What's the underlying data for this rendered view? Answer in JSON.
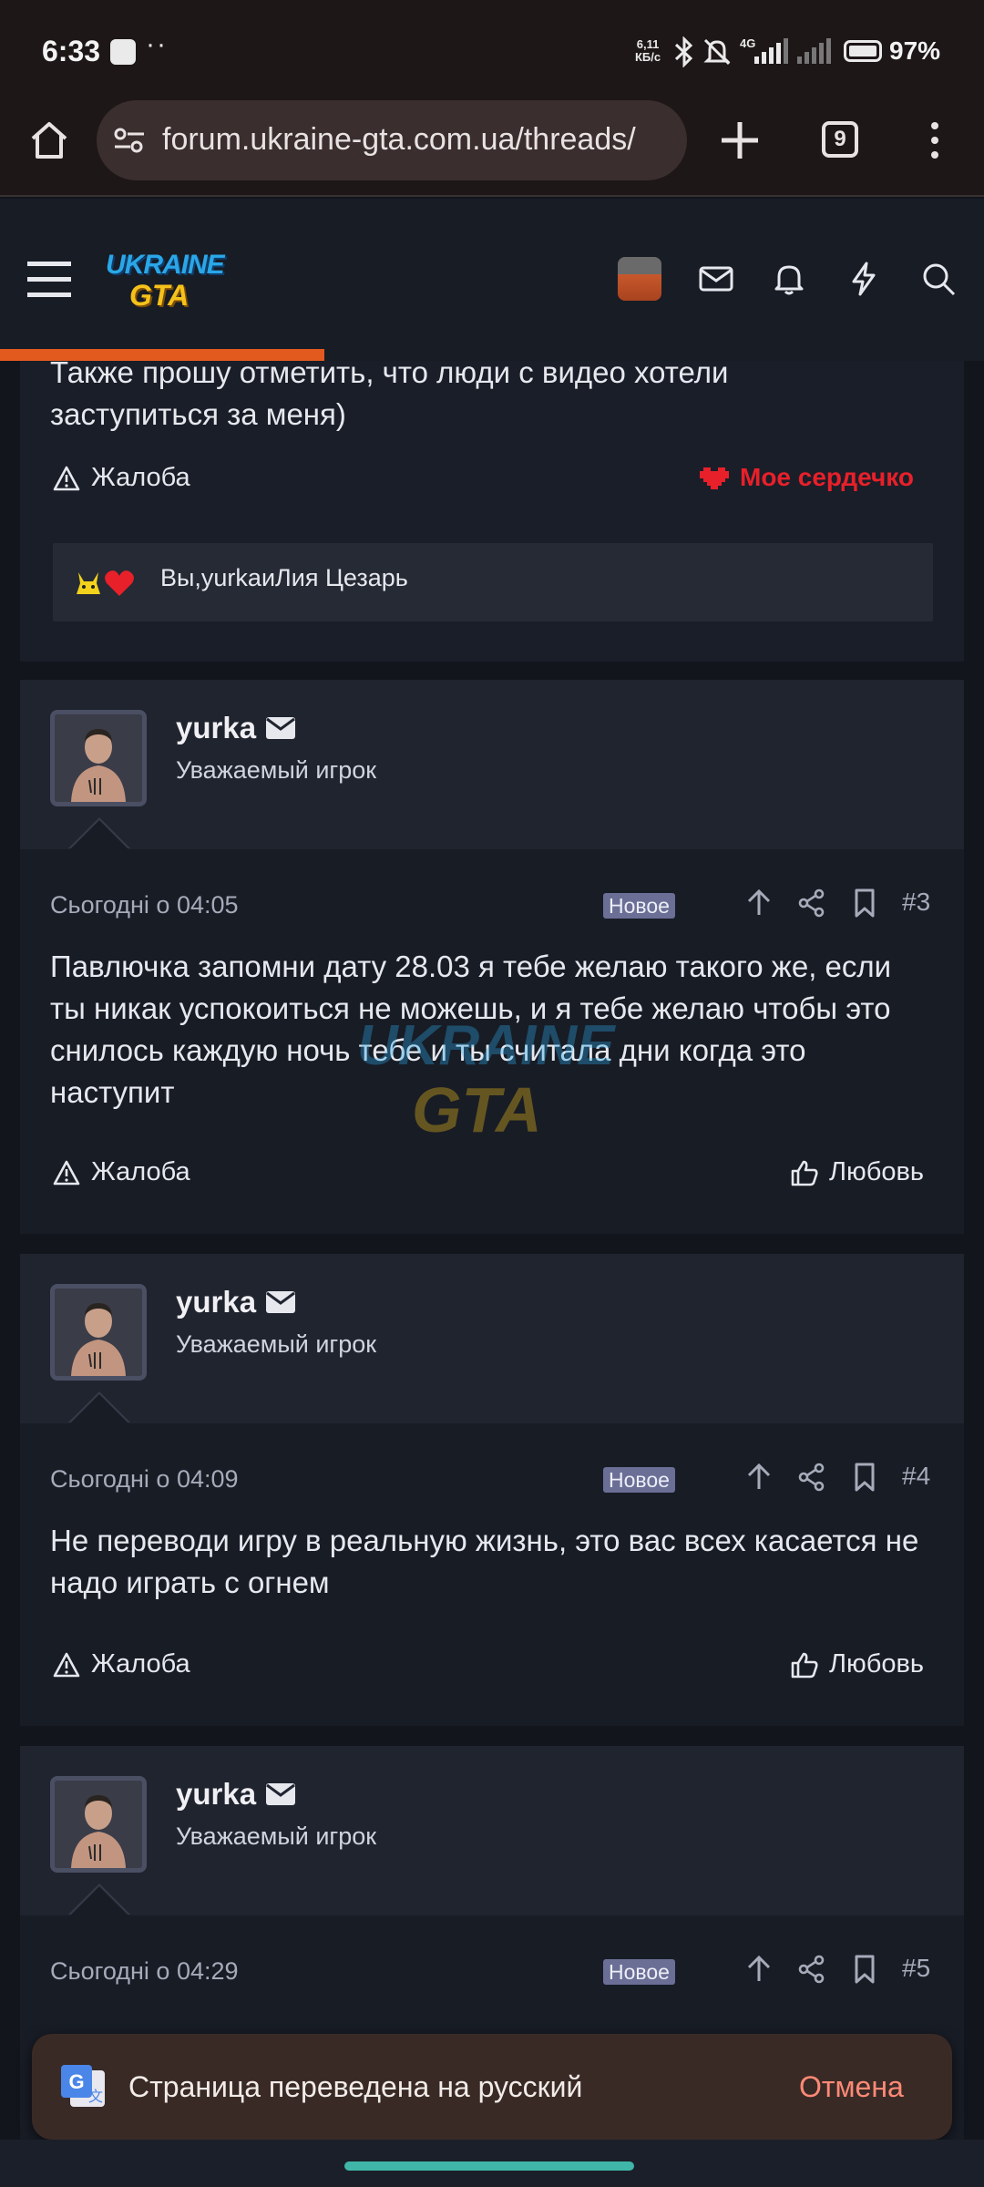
{
  "status_bar": {
    "time": "6:33",
    "net_speed_value": "6,11",
    "net_speed_unit": "КБ/с",
    "network": "4G",
    "battery": "97%"
  },
  "browser": {
    "url": "forum.ukraine-gta.com.ua/threads/",
    "tab_count": "9"
  },
  "site": {
    "logo_top": "UKRAINE",
    "logo_bottom": "GTA",
    "read_progress": 0.33
  },
  "top_post": {
    "text_line1": "Также прошу отметить, что люди с видео хотели",
    "text_line2": "заступиться за меня)",
    "report_label": "Жалоба",
    "reaction_label": "Мое сердечко",
    "reactions_text": "Вы,yurkaиЛия Цезарь"
  },
  "posts": [
    {
      "username": "yurka",
      "user_title": "Уважаемый игрок",
      "date": "Сьогодні о 04:05",
      "badge": "Новое",
      "number": "#3",
      "body": "Павлючка запомни дату 28.03 я тебе желаю такого же, если ты никак успокоиться не можешь, и я тебе желаю чтобы это снилось каждую ночь тебе и ты считала дни когда это наступит",
      "report_label": "Жалоба",
      "like_label": "Любовь"
    },
    {
      "username": "yurka",
      "user_title": "Уважаемый игрок",
      "date": "Сьогодні о 04:09",
      "badge": "Новое",
      "number": "#4",
      "body": "Не переводи игру в реальную жизнь, это вас всех касается не надо играть с огнем",
      "report_label": "Жалоба",
      "like_label": "Любовь"
    },
    {
      "username": "yurka",
      "user_title": "Уважаемый игрок",
      "date": "Сьогодні о 04:29",
      "badge": "Новое",
      "number": "#5"
    }
  ],
  "watermark": {
    "top": "UKRAINE",
    "bottom": "GTA"
  },
  "snackbar": {
    "message": "Страница переведена на русский",
    "action": "Отмена"
  }
}
